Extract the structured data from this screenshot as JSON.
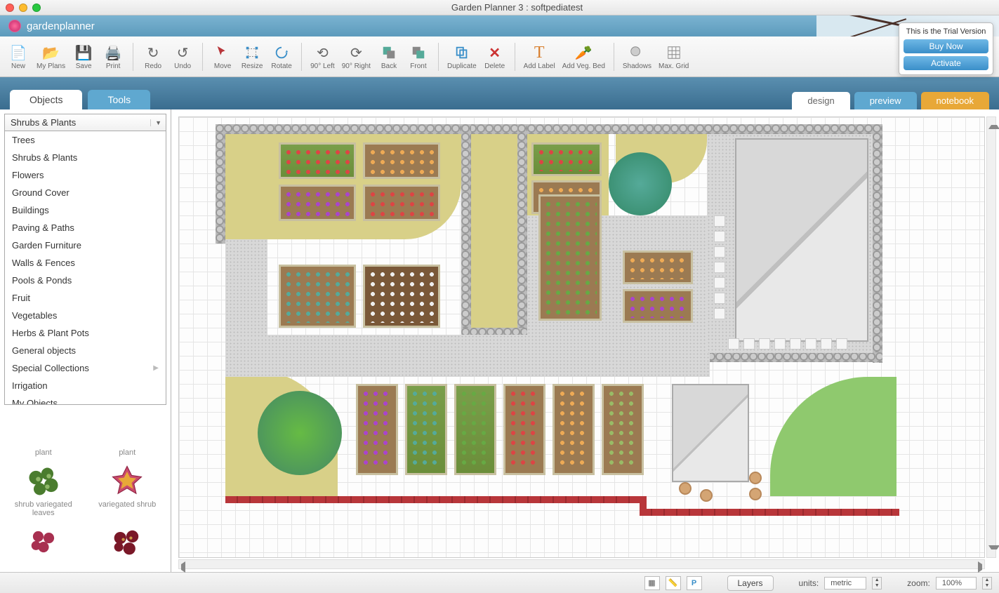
{
  "window": {
    "title": "Garden Planner 3 : softpediatest"
  },
  "brand": {
    "name": "gardenplanner"
  },
  "trial": {
    "message": "This is the Trial Version",
    "buy": "Buy Now",
    "activate": "Activate"
  },
  "toolbar": {
    "new": "New",
    "myplans": "My Plans",
    "save": "Save",
    "print": "Print",
    "redo": "Redo",
    "undo": "Undo",
    "move": "Move",
    "resize": "Resize",
    "rotate": "Rotate",
    "rot_left": "90° Left",
    "rot_right": "90° Right",
    "back": "Back",
    "front": "Front",
    "duplicate": "Duplicate",
    "delete": "Delete",
    "add_label": "Add Label",
    "add_veg": "Add Veg. Bed",
    "shadows": "Shadows",
    "maxgrid": "Max. Grid"
  },
  "left_tabs": {
    "objects": "Objects",
    "tools": "Tools"
  },
  "right_tabs": {
    "design": "design",
    "preview": "preview",
    "notebook": "notebook"
  },
  "category": {
    "selected": "Shrubs & Plants",
    "items": [
      "Trees",
      "Shrubs & Plants",
      "Flowers",
      "Ground Cover",
      "Buildings",
      "Paving & Paths",
      "Garden Furniture",
      "Walls & Fences",
      "Pools & Ponds",
      "Fruit",
      "Vegetables",
      "Herbs & Plant Pots",
      "General objects",
      "Special Collections",
      "Irrigation",
      "My Objects"
    ]
  },
  "palette": {
    "row1": [
      "plant",
      "plant"
    ],
    "row2": [
      "shrub variegated leaves",
      "variegated shrub"
    ]
  },
  "status": {
    "layers": "Layers",
    "units_label": "units:",
    "units_value": "metric",
    "zoom_label": "zoom:",
    "zoom_value": "100%",
    "p": "P"
  }
}
